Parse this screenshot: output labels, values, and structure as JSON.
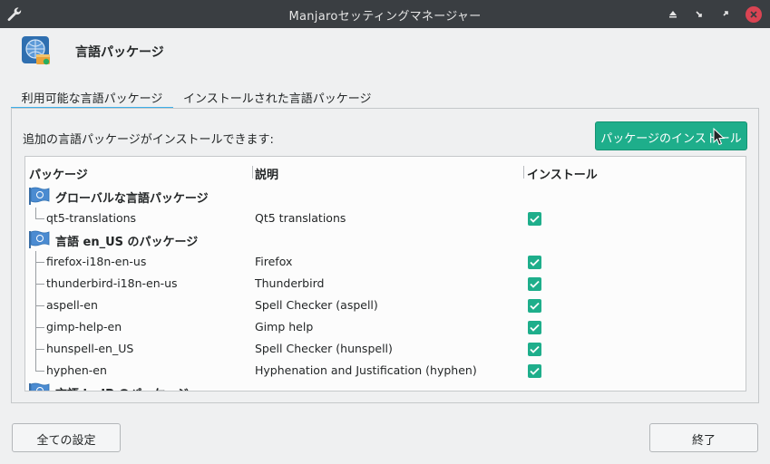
{
  "window": {
    "title": "Manjaroセッティングマネージャー",
    "controls": [
      "keep-above",
      "minimize",
      "maximize",
      "close"
    ]
  },
  "header": {
    "title": "言語パッケージ",
    "icon": "language-packages-icon"
  },
  "tabs": [
    {
      "label": "利用可能な言語パッケージ",
      "active": true
    },
    {
      "label": "インストールされた言語パッケージ",
      "active": false
    }
  ],
  "intro_text": "追加の言語パッケージがインストールできます:",
  "install_button": "パッケージのインストール",
  "table": {
    "columns": [
      "パッケージ",
      "説明",
      "インストール"
    ],
    "groups": [
      {
        "label": "グローバルな言語パッケージ",
        "items": [
          {
            "name": "qt5-translations",
            "description": "Qt5 translations",
            "checked": true
          }
        ]
      },
      {
        "label": "言語 en_US のパッケージ",
        "items": [
          {
            "name": "firefox-i18n-en-us",
            "description": "Firefox",
            "checked": true
          },
          {
            "name": "thunderbird-i18n-en-us",
            "description": "Thunderbird",
            "checked": true
          },
          {
            "name": "aspell-en",
            "description": "Spell Checker (aspell)",
            "checked": true
          },
          {
            "name": "gimp-help-en",
            "description": "Gimp help",
            "checked": true
          },
          {
            "name": "hunspell-en_US",
            "description": "Spell Checker (hunspell)",
            "checked": true
          },
          {
            "name": "hyphen-en",
            "description": "Hyphenation and Justification (hyphen)",
            "checked": true
          }
        ]
      },
      {
        "label": "言語 ja_JP のパッケージ",
        "items": []
      }
    ]
  },
  "footer": {
    "all_settings": "全ての設定",
    "quit": "終了"
  },
  "colors": {
    "accent": "#1eae8b",
    "titlebar": "#3a3e42",
    "close": "#da4453",
    "tab_underline": "#3daee9"
  }
}
